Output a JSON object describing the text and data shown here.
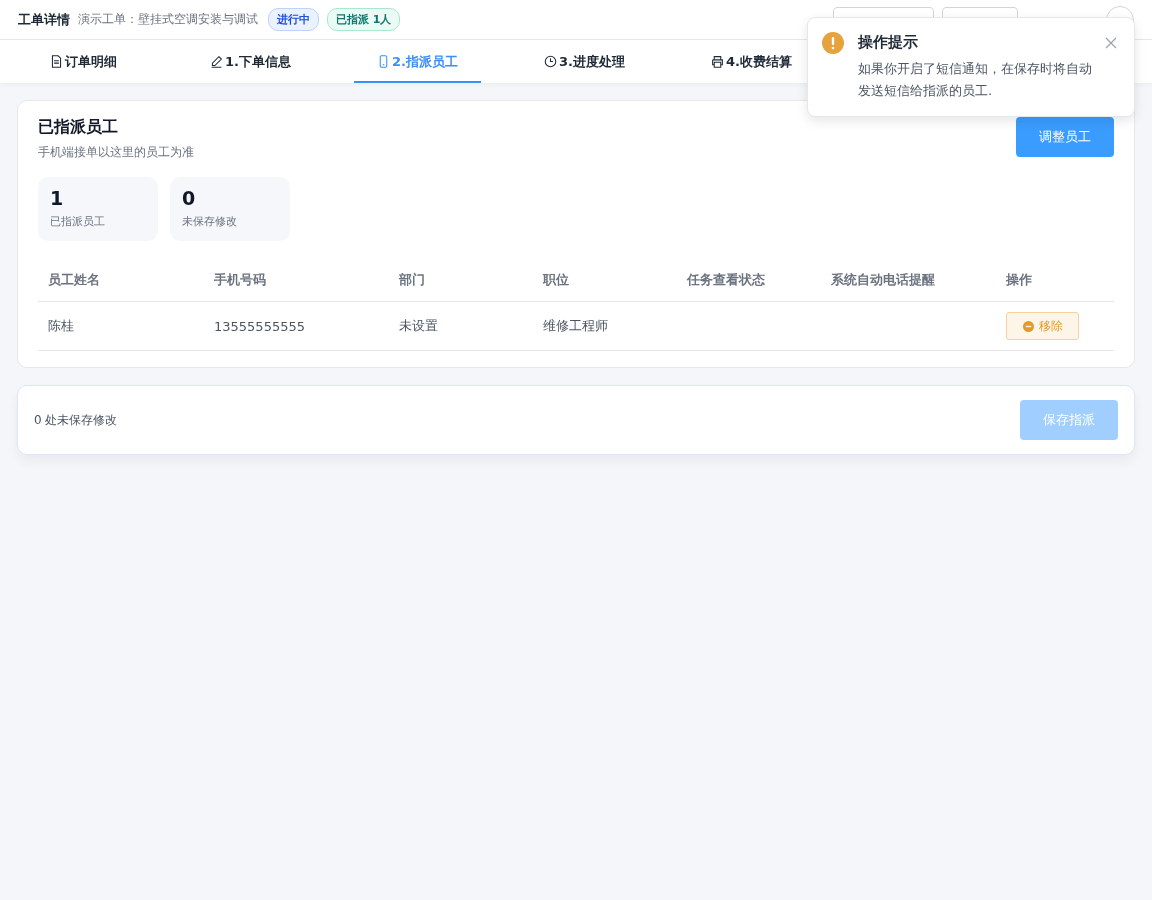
{
  "header": {
    "title": "工单详情",
    "subtitle": "演示工单：壁挂式空调安装与调试",
    "badges": [
      {
        "label": "进行中",
        "kind": "status"
      },
      {
        "label": "已指派 1人",
        "kind": "assigned"
      }
    ]
  },
  "tabs": [
    {
      "label": "订单明细",
      "kind": "doc",
      "selected": false
    },
    {
      "label": "1.下单信息",
      "kind": "pen",
      "selected": false
    },
    {
      "label": "2.指派员工",
      "kind": "phone",
      "selected": true
    },
    {
      "label": "3.进度处理",
      "kind": "clock",
      "selected": false
    },
    {
      "label": "4.收费结算",
      "kind": "printer",
      "selected": false
    }
  ],
  "panel": {
    "title": "已指派员工",
    "subtitle": "手机端接单以这里的员工为准",
    "action": "调整员工",
    "stats": [
      {
        "value": "1",
        "label": "已指派员工"
      },
      {
        "value": "0",
        "label": "未保存修改"
      }
    ],
    "table": {
      "columns": [
        "员工姓名",
        "手机号码",
        "部门",
        "职位",
        "任务查看状态",
        "系统自动电话提醒",
        "操作"
      ],
      "rows": [
        {
          "cells": [
            "陈桂",
            "13555555555",
            "未设置",
            "维修工程师",
            "",
            ""
          ],
          "action": "移除"
        }
      ]
    }
  },
  "footer": {
    "text": "0 处未保存修改",
    "button": {
      "label": "保存指派",
      "disabled": true
    }
  },
  "toast": {
    "title": "操作提示",
    "message": "如果你开启了短信通知，在保存时将自动发送短信给指派的员工."
  }
}
